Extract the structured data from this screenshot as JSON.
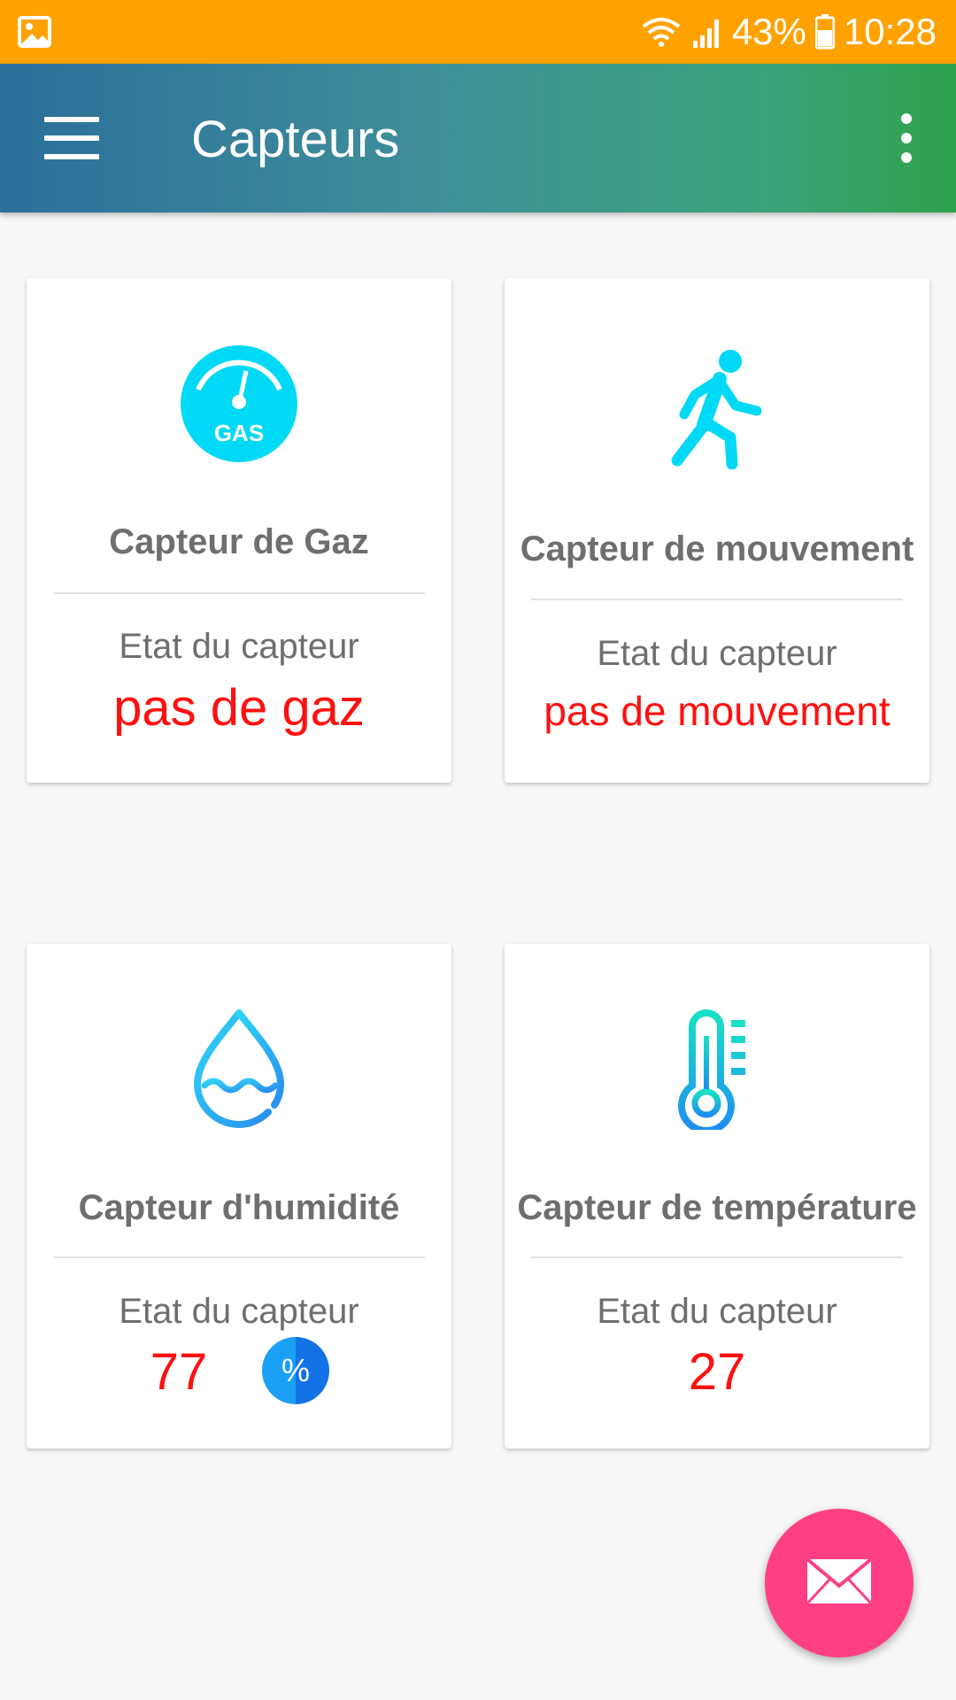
{
  "status_bar": {
    "battery": "43%",
    "time": "10:28"
  },
  "app_bar": {
    "title": "Capteurs"
  },
  "cards": [
    {
      "name": "Capteur de Gaz",
      "state_label": "Etat du capteur",
      "value": "pas de gaz",
      "icon": "gas-meter-icon"
    },
    {
      "name": "Capteur de mouvement",
      "state_label": "Etat du capteur",
      "value": "pas de mouvement",
      "icon": "walking-person-icon"
    },
    {
      "name": "Capteur d'humidité",
      "state_label": "Etat du capteur",
      "value": "77",
      "unit_badge": "%",
      "icon": "water-drop-icon"
    },
    {
      "name": "Capteur de température",
      "state_label": "Etat du capteur",
      "value": "27",
      "icon": "thermometer-icon"
    }
  ],
  "colors": {
    "status_bar": "#ffa200",
    "value_red": "#ff1010",
    "icon_cyan": "#00d9f5",
    "fab_pink": "#ff3f84"
  }
}
